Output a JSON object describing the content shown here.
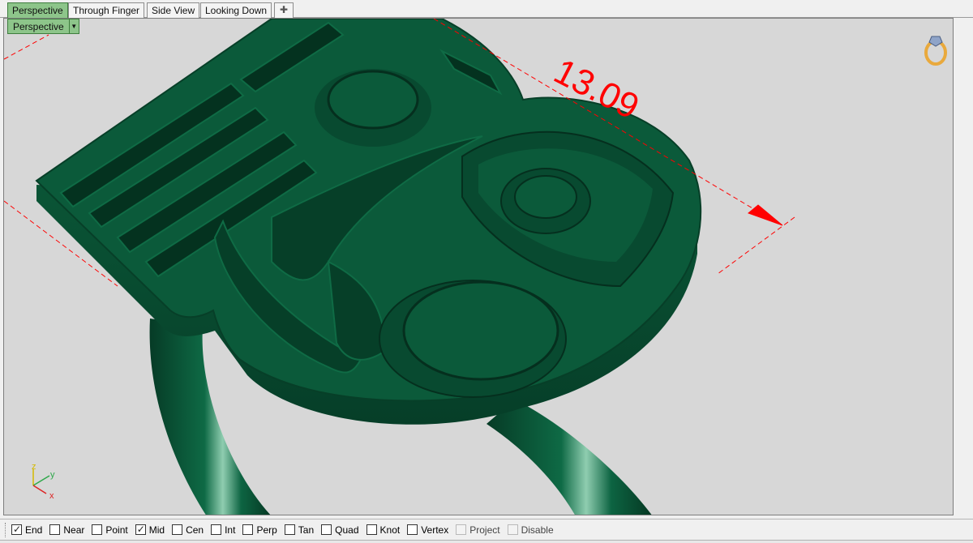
{
  "tabs": [
    {
      "label": "Perspective",
      "active": true
    },
    {
      "label": "Through Finger",
      "active": false
    },
    {
      "label": "Side View",
      "active": false
    },
    {
      "label": "Looking Down",
      "active": false
    }
  ],
  "add_tab_icon": "plus-icon",
  "viewport": {
    "label": "Perspective",
    "dropdown_icon": "dropdown-arrow-icon",
    "dimension_text": "13.09",
    "axis": {
      "x": "x",
      "y": "y",
      "z": "z"
    },
    "model_color": "#0b5a3a",
    "dimension_color": "#ff0000",
    "background_color": "#d7d7d7"
  },
  "osnap": [
    {
      "label": "End",
      "checked": true,
      "enabled": true
    },
    {
      "label": "Near",
      "checked": false,
      "enabled": true
    },
    {
      "label": "Point",
      "checked": false,
      "enabled": true
    },
    {
      "label": "Mid",
      "checked": true,
      "enabled": true
    },
    {
      "label": "Cen",
      "checked": false,
      "enabled": true
    },
    {
      "label": "Int",
      "checked": false,
      "enabled": true
    },
    {
      "label": "Perp",
      "checked": false,
      "enabled": true
    },
    {
      "label": "Tan",
      "checked": false,
      "enabled": true
    },
    {
      "label": "Quad",
      "checked": false,
      "enabled": true
    },
    {
      "label": "Knot",
      "checked": false,
      "enabled": true
    },
    {
      "label": "Vertex",
      "checked": false,
      "enabled": true
    },
    {
      "label": "Project",
      "checked": false,
      "enabled": false
    },
    {
      "label": "Disable",
      "checked": false,
      "enabled": false
    }
  ]
}
